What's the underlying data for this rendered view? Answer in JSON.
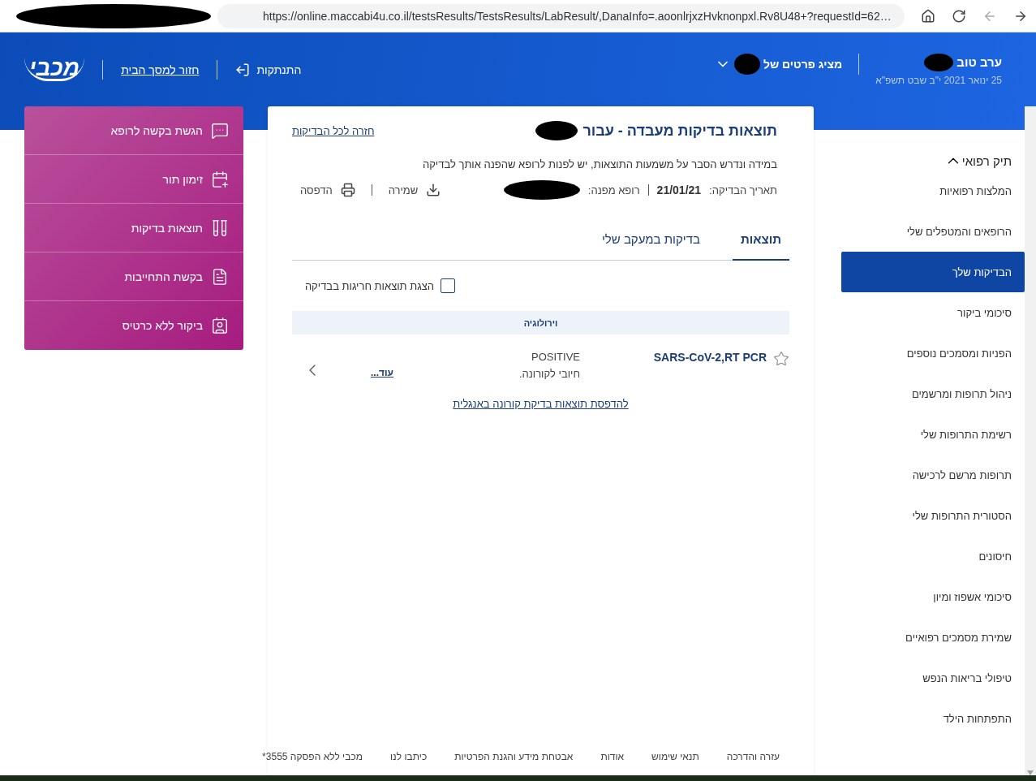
{
  "browser": {
    "url": "https://online.maccabi4u.co.il/testsResults/TestsResults/LabResult/,DanaInfo=.aoonlrjxzHvknonpxl.Rv8U48+?requestId=62…"
  },
  "header": {
    "greeting": "ערב טוב",
    "date": "25 ינואר 2021 י\"ב שבט תשפ\"א",
    "viewing_label": "מציג פרטים של",
    "logout": "התנתקות",
    "home_link": "חזור למסך הבית",
    "logo": "מכבי"
  },
  "quick_actions": [
    {
      "label": "הגשת בקשה לרופא"
    },
    {
      "label": "זימון תור"
    },
    {
      "label": "תוצאות בדיקות"
    },
    {
      "label": "בקשת התחייבות"
    },
    {
      "label": "ביקור ללא כרטיס"
    }
  ],
  "main": {
    "title": "תוצאות בדיקות מעבדה - עבור",
    "back_link": "חזרה לכל הבדיקות",
    "notice": "במידה ונדרש הסבר על משמעות התוצאות, יש לפנות לרופא שהפנה אותך לבדיקה",
    "date_label": "תאריך הבדיקה:",
    "date": "21/01/21",
    "doctor_label": "רופא מפנה:",
    "save": "שמירה",
    "print": "הדפסה",
    "tabs": [
      {
        "label": "תוצאות",
        "selected": true
      },
      {
        "label": "בדיקות במעקב שלי",
        "selected": false
      }
    ],
    "checkbox": {
      "label": "הצגת תוצאות חריגות בבדיקה",
      "checked": false
    },
    "sections": [
      {
        "title": "וירולוגיה",
        "results": [
          {
            "name": "SARS-CoV-2,RT PCR",
            "value": "POSITIVE",
            "note": "חיובי לקורונה.",
            "more": "עוד...",
            "starred": false
          }
        ]
      }
    ],
    "english_link": "להדפסת תוצאות בדיקת קורונה באנגלית"
  },
  "footer": [
    "עזרה והדרכה",
    "תנאי שימוש",
    "אודות",
    "אבטחת מידע והגנת הפרטיות",
    "כיתבו לנו",
    "מכבי ללא הפסקה 3555*"
  ],
  "sidebar": {
    "title": "תיק רפואי",
    "expanded": true,
    "items": [
      {
        "label": "המלצות רפואיות",
        "selected": false
      },
      {
        "label": "הרופאים והמטפלים שלי",
        "selected": false
      },
      {
        "label": "הבדיקות שלך",
        "selected": true
      },
      {
        "label": "סיכומי ביקור",
        "selected": false
      },
      {
        "label": "הפניות ומסמכים נוספים",
        "selected": false
      },
      {
        "label": "ניהול תרופות ומרשמים",
        "selected": false
      },
      {
        "label": "רשימת התרופות שלי",
        "selected": false
      },
      {
        "label": "תרופות מרשם לרכישה",
        "selected": false
      },
      {
        "label": "הסטורית התרופות שלי",
        "selected": false
      },
      {
        "label": "חיסונים",
        "selected": false
      },
      {
        "label": "סיכומי אשפוז ומיון",
        "selected": false
      },
      {
        "label": "שמירת מסמכים רפואיים",
        "selected": false
      },
      {
        "label": "טיפולי בריאות הנפש",
        "selected": false
      },
      {
        "label": "התפתחות הילד",
        "selected": false
      }
    ]
  }
}
